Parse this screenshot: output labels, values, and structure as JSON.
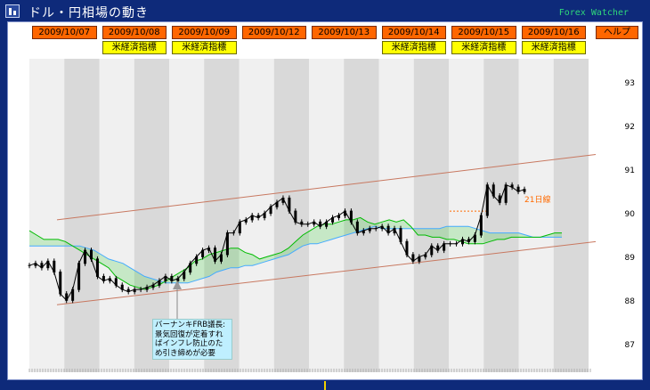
{
  "window": {
    "title": "ドル・円相場の動き",
    "brand": "Forex Watcher"
  },
  "dates": [
    "2009/10/07",
    "2009/10/08",
    "2009/10/09",
    "2009/10/12",
    "2009/10/13",
    "2009/10/14",
    "2009/10/15",
    "2009/10/16"
  ],
  "help_label": "ヘルプ",
  "indicator_label": "米経済指標",
  "indicator_days": [
    1,
    2,
    5,
    6,
    7
  ],
  "ma_label": "21日線",
  "annotation": "バーナンキFRB議長:景気回復が定着すればインフレ防止のため引き締めが必要",
  "colors": {
    "date_button": "#ff6600",
    "indicator_button": "#ffff00",
    "band_light": "#f0f0f0",
    "band_dark": "#d9d9d9",
    "price": "#000000",
    "cloud_line_a": "#00bb00",
    "cloud_line_b": "#44aaff",
    "cloud_fill": "#33cc33",
    "trend_channel": "#c87860",
    "ma21": "#ff6a00",
    "annotation_bg": "#bfefff"
  },
  "chart_data": {
    "type": "line",
    "title": "ドル・円相場の動き",
    "xlabel": "",
    "ylabel": "",
    "ylim": [
      86.4,
      93.6
    ],
    "y_ticks": [
      87,
      88,
      89,
      90,
      91,
      92,
      93
    ],
    "grid": false,
    "series": [
      {
        "role": "price",
        "values": [
          88.85,
          88.9,
          88.8,
          88.95,
          88.7,
          88.2,
          88.05,
          88.3,
          88.9,
          89.2,
          89.0,
          88.6,
          88.5,
          88.55,
          88.4,
          88.3,
          88.25,
          88.3,
          88.3,
          88.35,
          88.4,
          88.5,
          88.6,
          88.5,
          88.55,
          88.7,
          88.9,
          89.05,
          89.2,
          89.25,
          88.95,
          89.1,
          89.6,
          89.6,
          89.85,
          89.9,
          90.0,
          89.95,
          90.05,
          90.2,
          90.3,
          90.4,
          90.1,
          89.85,
          89.8,
          89.8,
          89.85,
          89.75,
          89.85,
          89.95,
          90.0,
          90.1,
          89.85,
          89.6,
          89.65,
          89.7,
          89.7,
          89.75,
          89.6,
          89.7,
          89.4,
          89.1,
          88.95,
          89.05,
          89.1,
          89.3,
          89.2,
          89.35,
          89.35,
          89.35,
          89.45,
          89.4,
          89.55,
          90.0,
          90.7,
          90.45,
          90.3,
          90.7,
          90.65,
          90.55,
          90.6
        ]
      },
      {
        "role": "cloud-line-a",
        "values": [
          89.65,
          89.55,
          89.45,
          89.45,
          89.45,
          89.4,
          89.3,
          89.2,
          89.1,
          89.0,
          88.9,
          88.8,
          88.6,
          88.5,
          88.4,
          88.35,
          88.3,
          88.35,
          88.4,
          88.5,
          88.6,
          88.7,
          88.8,
          88.95,
          89.0,
          89.1,
          89.15,
          89.2,
          89.25,
          89.25,
          89.15,
          89.1,
          89.0,
          89.05,
          89.1,
          89.15,
          89.25,
          89.4,
          89.55,
          89.65,
          89.75,
          89.8,
          89.8,
          89.85,
          89.9,
          89.9,
          89.95,
          89.85,
          89.8,
          89.85,
          89.9,
          89.85,
          89.9,
          89.75,
          89.55,
          89.55,
          89.5,
          89.5,
          89.45,
          89.45,
          89.4,
          89.35,
          89.35,
          89.35,
          89.4,
          89.45,
          89.45,
          89.5,
          89.5,
          89.5,
          89.5,
          89.5,
          89.55,
          89.6,
          89.6
        ]
      },
      {
        "role": "cloud-line-b",
        "values": [
          89.3,
          89.3,
          89.3,
          89.3,
          89.3,
          89.3,
          89.3,
          89.3,
          89.25,
          89.2,
          89.1,
          89.0,
          88.95,
          88.9,
          88.8,
          88.7,
          88.6,
          88.55,
          88.5,
          88.45,
          88.45,
          88.45,
          88.45,
          88.5,
          88.55,
          88.6,
          88.7,
          88.75,
          88.8,
          88.8,
          88.85,
          88.85,
          88.9,
          88.95,
          89.0,
          89.05,
          89.1,
          89.2,
          89.3,
          89.35,
          89.35,
          89.4,
          89.45,
          89.5,
          89.55,
          89.6,
          89.65,
          89.7,
          89.75,
          89.7,
          89.7,
          89.7,
          89.7,
          89.7,
          89.7,
          89.7,
          89.7,
          89.7,
          89.75,
          89.75,
          89.75,
          89.75,
          89.7,
          89.65,
          89.6,
          89.6,
          89.6,
          89.6,
          89.6,
          89.55,
          89.5,
          89.5,
          89.5,
          89.5,
          89.5
        ]
      }
    ],
    "trend_channel": {
      "upper": [
        89.9,
        91.4
      ],
      "lower": [
        87.95,
        89.4
      ]
    },
    "ma21_level": 90.1
  }
}
